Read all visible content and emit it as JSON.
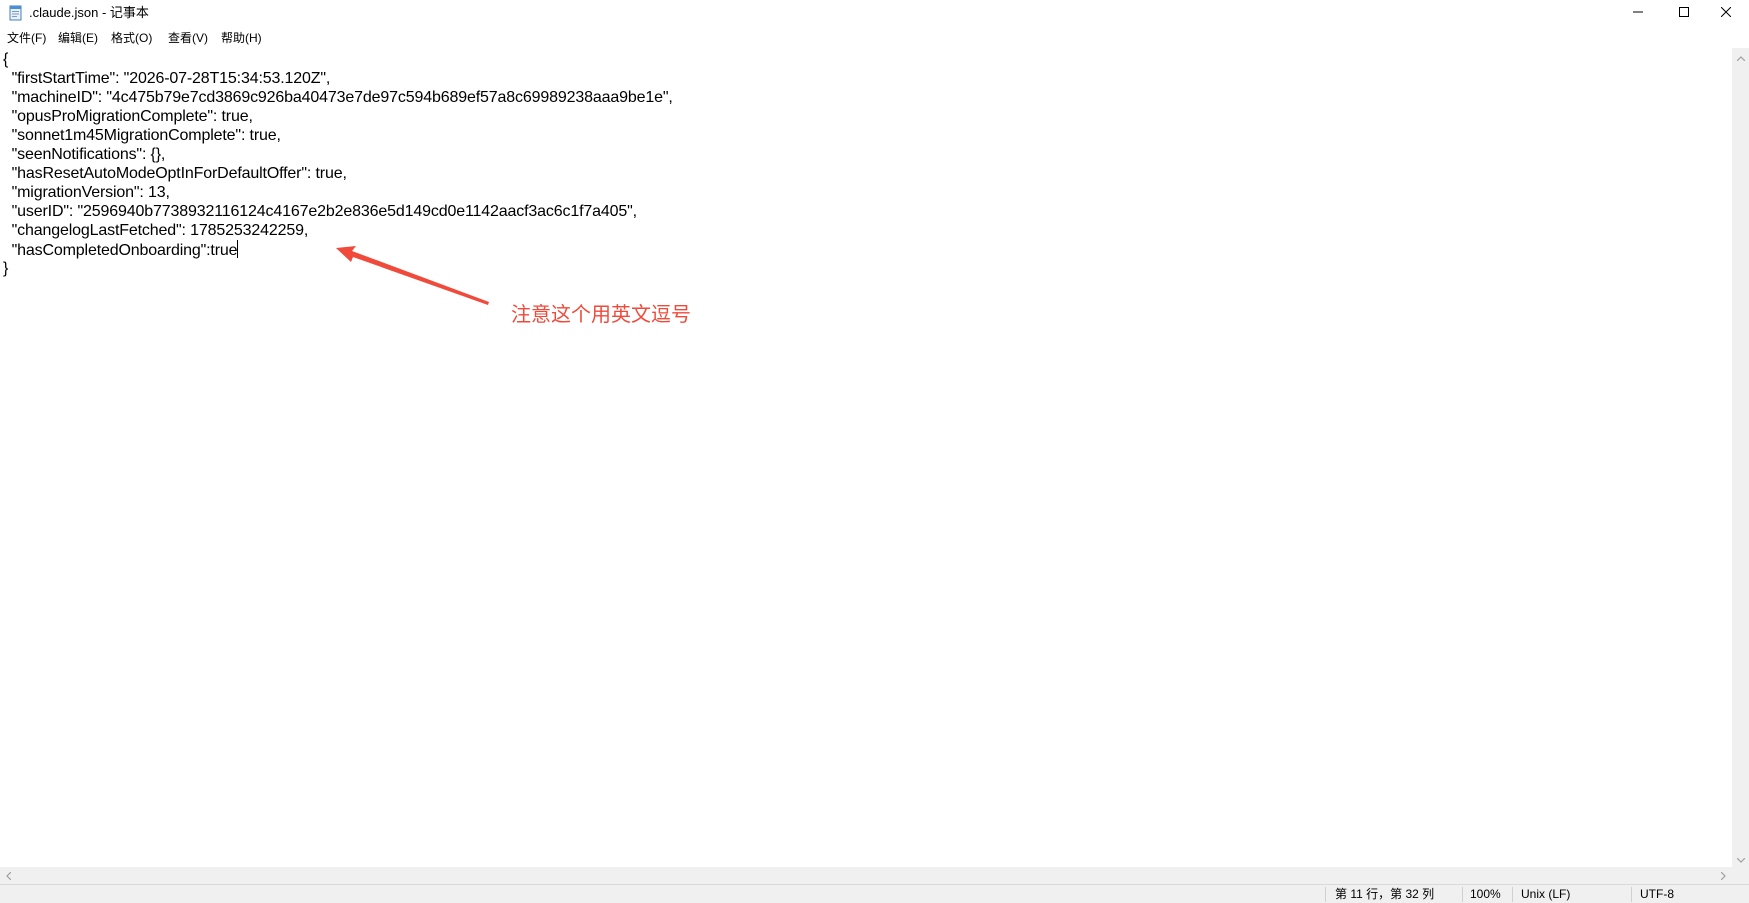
{
  "window": {
    "title": ".claude.json - 记事本",
    "app_icon": "notepad-icon",
    "controls": {
      "minimize_icon": "minimize-icon",
      "maximize_icon": "maximize-icon",
      "close_icon": "close-icon"
    }
  },
  "menu": {
    "file": "文件(F)",
    "edit": "编辑(E)",
    "format": "格式(O)",
    "view": "查看(V)",
    "help": "帮助(H)"
  },
  "editor": {
    "lines": [
      "{",
      "  \"firstStartTime\": \"2026-07-28T15:34:53.120Z\",",
      "  \"machineID\": \"4c475b79e7cd3869c926ba40473e7de97c594b689ef57a8c69989238aaa9be1e\",",
      "  \"opusProMigrationComplete\": true,",
      "  \"sonnet1m45MigrationComplete\": true,",
      "  \"seenNotifications\": {},",
      "  \"hasResetAutoModeOptInForDefaultOffer\": true,",
      "  \"migrationVersion\": 13,",
      "  \"userID\": \"2596940b7738932116124c4167e2b2e836e5d149cd0e1142aacf3ac6c1f7a405\",",
      "  \"changelogLastFetched\": 1785253242259,",
      "  \"hasCompletedOnboarding\":true",
      "}"
    ]
  },
  "annotation": {
    "text": "注意这个用英文逗号",
    "color": "#f04a3b"
  },
  "status": {
    "position": "第 11 行，第 32 列",
    "zoom": "100%",
    "line_ending": "Unix (LF)",
    "encoding": "UTF-8"
  },
  "scrollbars": {
    "up_icon": "scroll-up-arrow-icon",
    "down_icon": "scroll-down-arrow-icon",
    "left_icon": "scroll-left-arrow-icon",
    "right_icon": "scroll-right-arrow-icon"
  }
}
